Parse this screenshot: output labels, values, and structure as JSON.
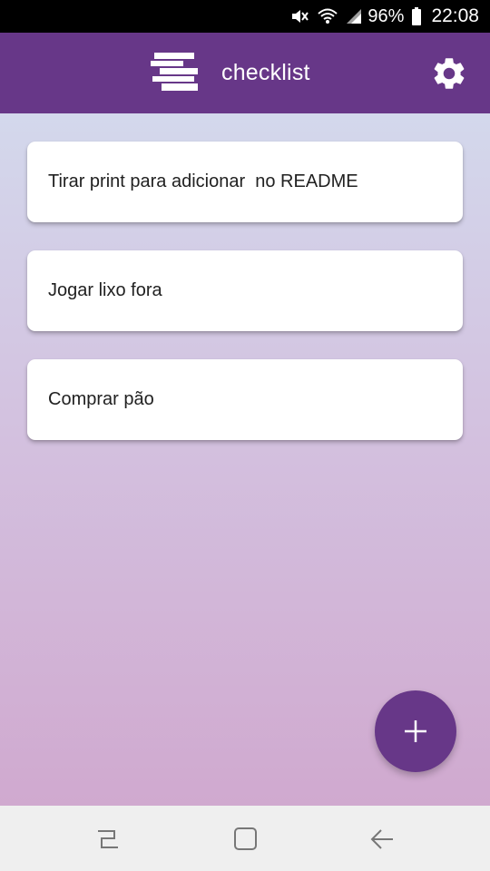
{
  "status_bar": {
    "icons": [
      "mute-icon",
      "wifi-icon",
      "signal-icon"
    ],
    "battery_percent": "96%",
    "battery_icon": "battery-icon",
    "time": "22:08"
  },
  "app_bar": {
    "logo_icon": "checklist-logo-icon",
    "title": "checklist",
    "settings_icon": "gear-icon",
    "background": "#673788"
  },
  "tasks": [
    {
      "text": "Tirar print para adicionar  no README"
    },
    {
      "text": "Jogar lixo fora"
    },
    {
      "text": "Comprar pão"
    }
  ],
  "fab": {
    "icon": "plus-icon",
    "background": "#673788"
  },
  "nav_bar": {
    "buttons": [
      "recent-apps-icon",
      "home-icon",
      "back-icon"
    ]
  }
}
